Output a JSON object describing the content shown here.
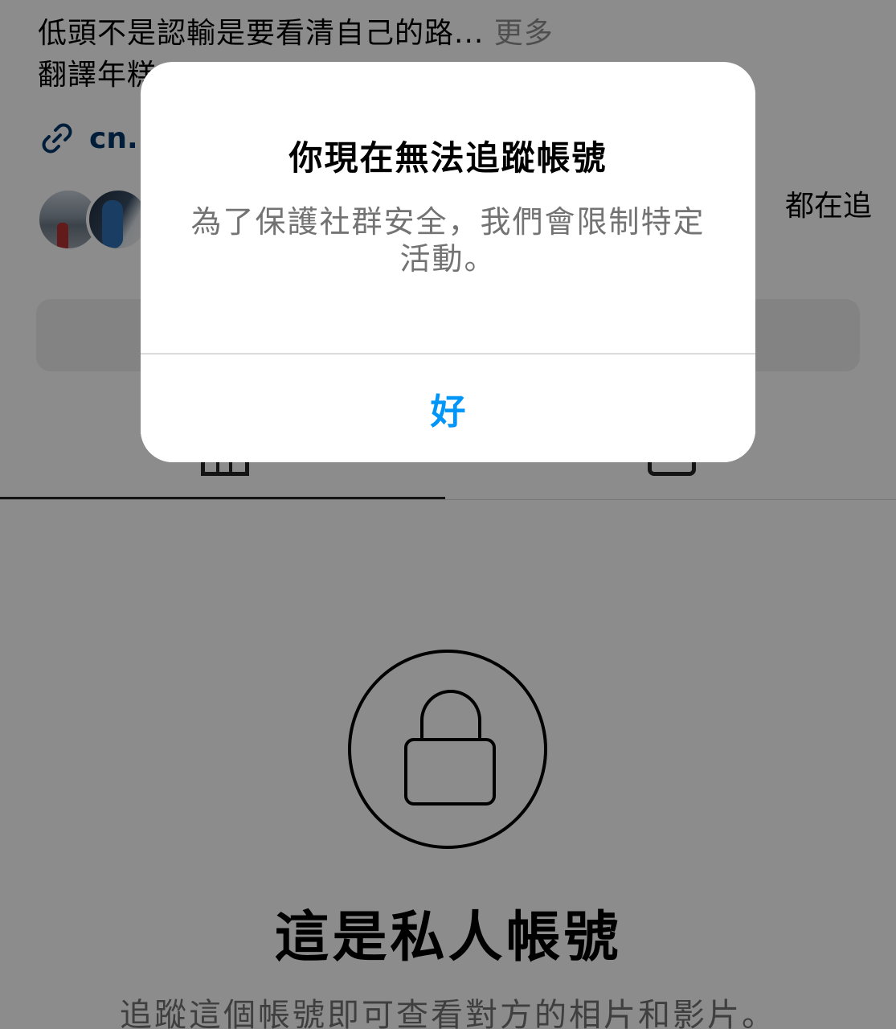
{
  "profile": {
    "bio_line_1": "低頭不是認輸是要看清自己的路...",
    "bio_more": "更多",
    "bio_line_2": "翻譯年糕",
    "link_text": "cn.",
    "followers_text": "都在追"
  },
  "tabs": {
    "grid_icon": "grid-icon",
    "tagged_icon": "tagged-icon"
  },
  "private_account": {
    "icon": "lock-icon",
    "title": "這是私人帳號",
    "subtitle": "追蹤這個帳號即可查看對方的相片和影片。"
  },
  "dialog": {
    "title": "你現在無法追蹤帳號",
    "message": "為了保護社群安全，我們會限制特定活動。",
    "ok_label": "好"
  },
  "colors": {
    "accent": "#0095f6",
    "link": "#00376b",
    "secondary_text": "#737373",
    "overlay": "rgba(0,0,0,0.45)"
  }
}
